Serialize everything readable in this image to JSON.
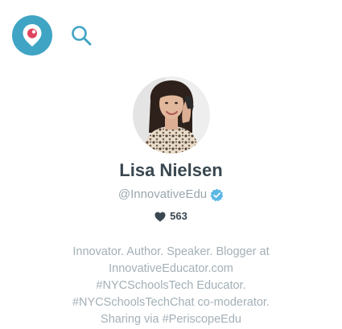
{
  "header": {
    "logo_icon": "periscope-logo-icon",
    "search_icon": "search-icon",
    "accent_color": "#40a4c4"
  },
  "profile": {
    "avatar_icon": "profile-photo",
    "name": "Lisa Nielsen",
    "handle": "@InnovativeEdu",
    "verified_icon": "verified-badge-icon",
    "hearts_icon": "heart-icon",
    "hearts_count": "563",
    "bio_lines": [
      "Innovator. Author. Speaker. Blogger at",
      "InnovativeEducator.com",
      "#NYCSchoolsTech Educator.",
      "#NYCSchoolsTechChat co-moderator.",
      "Sharing via #PeriscopeEdu"
    ]
  }
}
